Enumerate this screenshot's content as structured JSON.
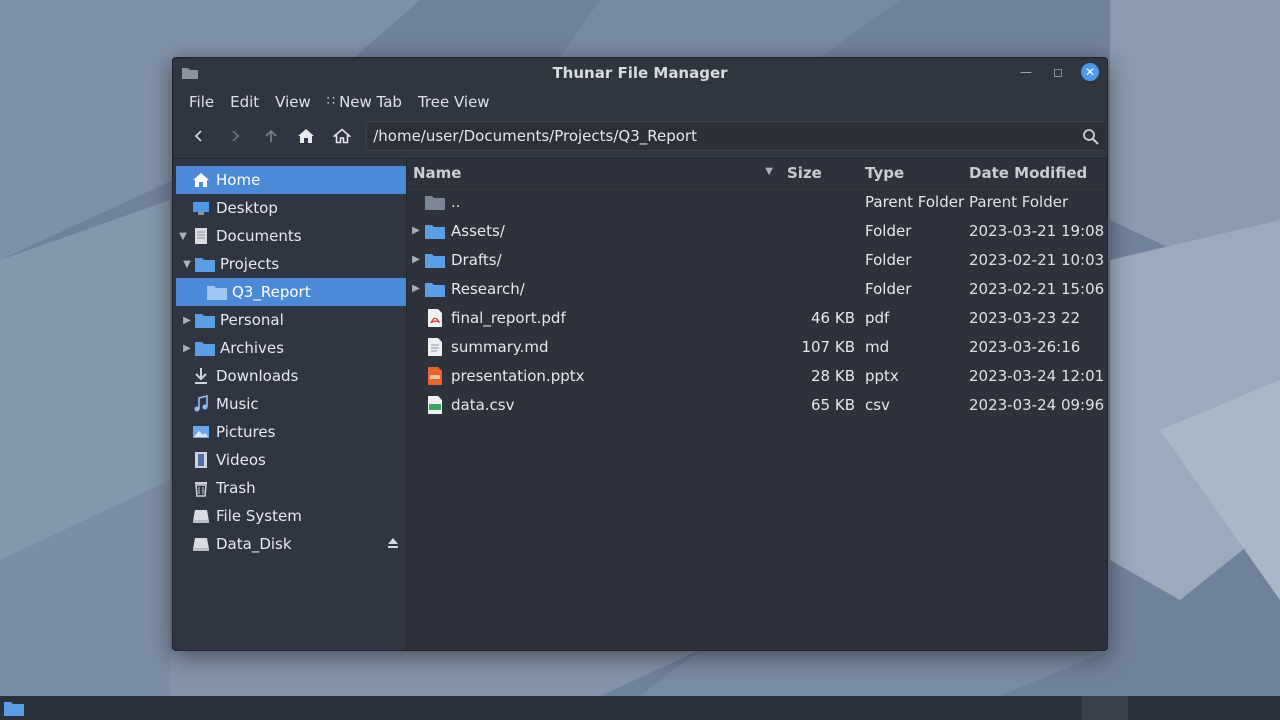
{
  "window": {
    "title": "Thunar File Manager"
  },
  "menu": [
    "File",
    "Edit",
    "View",
    "New Tab",
    "Tree View"
  ],
  "location": {
    "path": "/home/user/Documents/Projects/Q3_Report"
  },
  "sidebar": {
    "items": [
      {
        "label": "Home",
        "icon": "home-icon",
        "selected": true,
        "expander": ""
      },
      {
        "label": "Desktop",
        "icon": "desktop-icon",
        "selected": false,
        "expander": ""
      },
      {
        "label": "Documents",
        "icon": "document-icon",
        "selected": false,
        "expander": "expanded"
      },
      {
        "label": "Projects",
        "icon": "folder-icon",
        "selected": false,
        "expander": "expanded"
      },
      {
        "label": "Q3_Report",
        "icon": "folder-icon",
        "selected": true,
        "expander": ""
      },
      {
        "label": "Personal",
        "icon": "folder-icon",
        "selected": false,
        "expander": "collapsed"
      },
      {
        "label": "Archives",
        "icon": "folder-icon",
        "selected": false,
        "expander": "collapsed"
      },
      {
        "label": "Downloads",
        "icon": "download-icon",
        "selected": false,
        "expander": ""
      },
      {
        "label": "Music",
        "icon": "music-icon",
        "selected": false,
        "expander": ""
      },
      {
        "label": "Pictures",
        "icon": "pictures-icon",
        "selected": false,
        "expander": ""
      },
      {
        "label": "Videos",
        "icon": "videos-icon",
        "selected": false,
        "expander": ""
      },
      {
        "label": "Trash",
        "icon": "trash-icon",
        "selected": false,
        "expander": ""
      },
      {
        "label": "File System",
        "icon": "drive-icon",
        "selected": false,
        "expander": ""
      },
      {
        "label": "Data_Disk",
        "icon": "drive-icon",
        "selected": false,
        "expander": "",
        "eject": true
      }
    ]
  },
  "columns": {
    "name": "Name",
    "size": "Size",
    "type": "Type",
    "date": "Date Modified"
  },
  "files": [
    {
      "name": "..",
      "size": "",
      "type": "Parent Folder",
      "date": "Parent Folder",
      "icon": "folder-icon",
      "expandable": false
    },
    {
      "name": "Assets/",
      "size": "",
      "type": "Folder",
      "date": "2023-03-21 19:08",
      "icon": "folder-icon",
      "expandable": true
    },
    {
      "name": "Drafts/",
      "size": "",
      "type": "Folder",
      "date": "2023-02-21 10:03",
      "icon": "folder-icon",
      "expandable": true
    },
    {
      "name": "Research/",
      "size": "",
      "type": "Folder",
      "date": "2023-02-21 15:06",
      "icon": "folder-icon",
      "expandable": true
    },
    {
      "name": "final_report.pdf",
      "size": "46 KB",
      "type": "pdf",
      "date": "2023-03-23 22",
      "icon": "pdf-icon",
      "expandable": false
    },
    {
      "name": "summary.md",
      "size": "107 KB",
      "type": "md",
      "date": "2023-03-26:16",
      "icon": "text-file-icon",
      "expandable": false
    },
    {
      "name": "presentation.pptx",
      "size": "28 KB",
      "type": "pptx",
      "date": "2023-03-24 12:01",
      "icon": "pptx-icon",
      "expandable": false
    },
    {
      "name": "data.csv",
      "size": "65 KB",
      "type": "csv",
      "date": "2023-03-24 09:96",
      "icon": "csv-icon",
      "expandable": false
    }
  ],
  "colors": {
    "accent": "#4c8ad8",
    "folder": "#5b9ee6",
    "window_bg": "#2f3542"
  }
}
